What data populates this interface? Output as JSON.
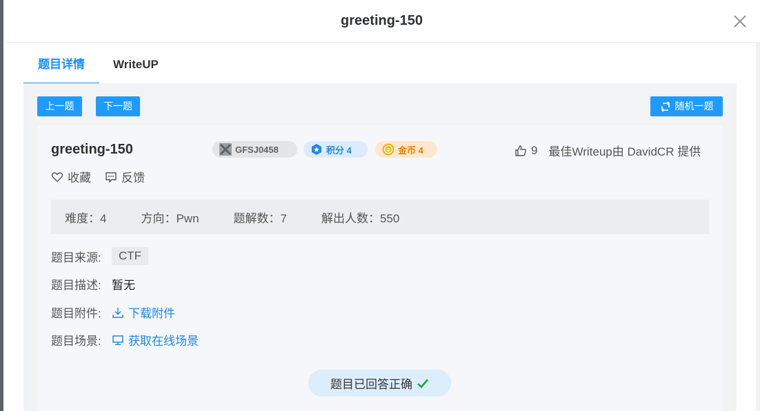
{
  "modal": {
    "title": "greeting-150"
  },
  "tabs": [
    {
      "label": "题目详情"
    },
    {
      "label": "WriteUP"
    }
  ],
  "toolbar": {
    "prev_label": "上一题",
    "next_label": "下一题",
    "random_label": "随机一题"
  },
  "question": {
    "title": "greeting-150",
    "id_badge": "GFSJ0458",
    "score_badge": "积分 4",
    "coin_badge": "金币 4",
    "likes": "9",
    "best_writeup": "最佳Writeup由 DavidCR 提供",
    "favorite_label": "收藏",
    "feedback_label": "反馈"
  },
  "stats": {
    "difficulty": "难度：4",
    "direction": "方向：Pwn",
    "solutions": "题解数：7",
    "solvers": "解出人数：550"
  },
  "details": {
    "source_label": "题目来源:",
    "source_value": "CTF",
    "desc_label": "题目描述:",
    "desc_value": "暂无",
    "attachment_label": "题目附件:",
    "attachment_link": "下载附件",
    "scene_label": "题目场景:",
    "scene_link": "获取在线场景"
  },
  "status": {
    "answered": "题目已回答正确"
  },
  "colors": {
    "accent": "#1e9bff",
    "success": "#22a33a",
    "coin": "#e67e00"
  }
}
